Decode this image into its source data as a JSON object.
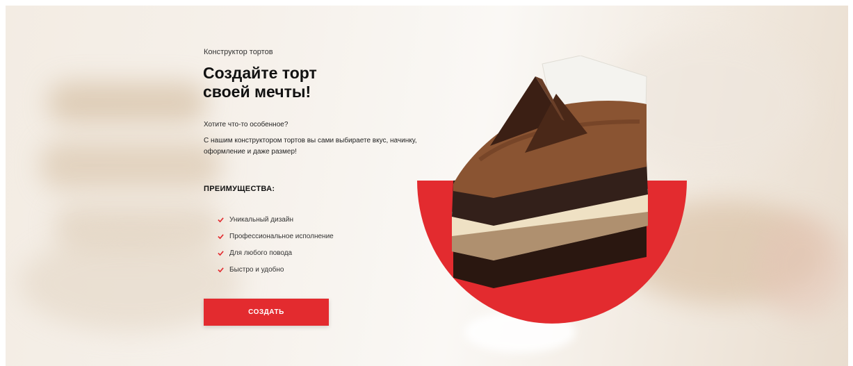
{
  "hero": {
    "eyebrow": "Конструктор тортов",
    "title_line1": "Создайте торт",
    "title_line2": "своей мечты!",
    "lead_question": "Хотите что-то особенное?",
    "lead_text": "С нашим конструктором тортов вы сами выбираете вкус, начинку, оформление и даже размер!"
  },
  "advantages": {
    "title": "ПРЕИМУЩЕСТВА:",
    "items": [
      "Уникальный дизайн",
      "Профессиональное исполнение",
      "Для любого повода",
      "Быстро и удобно"
    ]
  },
  "cta": {
    "label": "СОЗДАТЬ"
  },
  "icons": {
    "check": "check-icon"
  },
  "colors": {
    "accent": "#e32b2f",
    "text": "#111111"
  }
}
